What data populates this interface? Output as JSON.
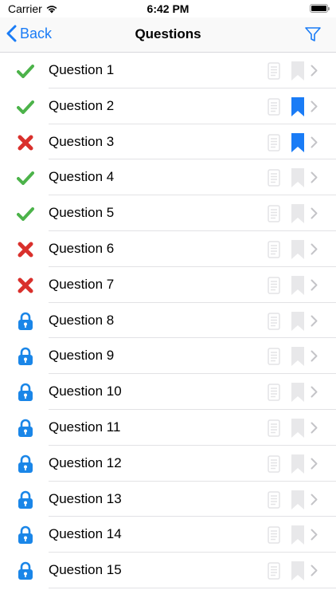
{
  "status_bar": {
    "carrier": "Carrier",
    "time": "6:42 PM"
  },
  "nav": {
    "back_label": "Back",
    "title": "Questions"
  },
  "colors": {
    "accent": "#1a7cf6",
    "correct": "#4cb34a",
    "wrong": "#d9302c",
    "locked": "#1a86e8",
    "bookmark_on": "#1a7cf6",
    "bookmark_off": "#e8e8ea"
  },
  "questions": [
    {
      "label": "Question 1",
      "status": "correct",
      "bookmarked": false
    },
    {
      "label": "Question 2",
      "status": "correct",
      "bookmarked": true
    },
    {
      "label": "Question 3",
      "status": "wrong",
      "bookmarked": true
    },
    {
      "label": "Question 4",
      "status": "correct",
      "bookmarked": false
    },
    {
      "label": "Question 5",
      "status": "correct",
      "bookmarked": false
    },
    {
      "label": "Question 6",
      "status": "wrong",
      "bookmarked": false
    },
    {
      "label": "Question 7",
      "status": "wrong",
      "bookmarked": false
    },
    {
      "label": "Question 8",
      "status": "locked",
      "bookmarked": false
    },
    {
      "label": "Question 9",
      "status": "locked",
      "bookmarked": false
    },
    {
      "label": "Question 10",
      "status": "locked",
      "bookmarked": false
    },
    {
      "label": "Question 11",
      "status": "locked",
      "bookmarked": false
    },
    {
      "label": "Question 12",
      "status": "locked",
      "bookmarked": false
    },
    {
      "label": "Question 13",
      "status": "locked",
      "bookmarked": false
    },
    {
      "label": "Question 14",
      "status": "locked",
      "bookmarked": false
    },
    {
      "label": "Question 15",
      "status": "locked",
      "bookmarked": false
    }
  ]
}
